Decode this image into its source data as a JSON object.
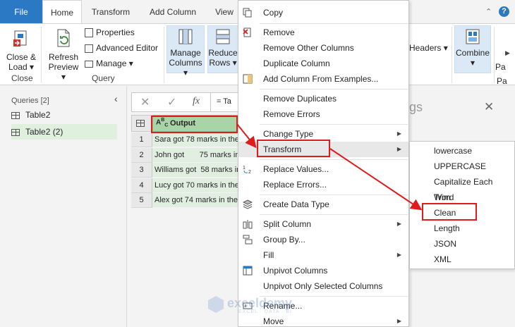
{
  "tabs": [
    {
      "label": "File"
    },
    {
      "label": "Home"
    },
    {
      "label": "Transform"
    },
    {
      "label": "Add Column"
    },
    {
      "label": "View"
    }
  ],
  "ribbon": {
    "close_load": "Close &\nLoad ▾",
    "close_load_1": "Close &",
    "close_load_2": "Load ▾",
    "close_group": "Close",
    "refresh_1": "Refresh",
    "refresh_2": "Preview ▾",
    "properties": "Properties",
    "advanced_editor": "Advanced Editor",
    "manage": "Manage ▾",
    "query_group": "Query",
    "manage_columns_1": "Manage",
    "manage_columns_2": "Columns ▾",
    "reduce_rows_1": "Reduce",
    "reduce_rows_2": "Rows ▾",
    "headers": "Headers ▾",
    "combine": "Combine",
    "combine_arrow": "▾",
    "cut_pa1": "Pa",
    "cut_pa2": "Pa",
    "help": "?"
  },
  "left_pane": {
    "header": "Queries [2]",
    "items": [
      "Table2",
      "Table2 (2)"
    ]
  },
  "formula_bar": {
    "fx": "fx",
    "eq_text": "= Ta"
  },
  "bg_title_fragment": "gs",
  "grid": {
    "column_header": "Output",
    "rows": [
      {
        "n": "1",
        "v": "Sara got 78 marks in the"
      },
      {
        "n": "2",
        "v": "John got       75 marks in"
      },
      {
        "n": "3",
        "v": "Williams got  58 marks in"
      },
      {
        "n": "4",
        "v": "Lucy got 70 marks in the"
      },
      {
        "n": "5",
        "v": "Alex got 74 marks in the"
      }
    ]
  },
  "context_menu": {
    "items": [
      "Copy",
      "Remove",
      "Remove Other Columns",
      "Duplicate Column",
      "Add Column From Examples...",
      "Remove Duplicates",
      "Remove Errors",
      "Change Type",
      "Transform",
      "Replace Values...",
      "Replace Errors...",
      "Create Data Type",
      "Split Column",
      "Group By...",
      "Fill",
      "Unpivot Columns",
      "Unpivot Only Selected Columns",
      "Rename...",
      "Move"
    ]
  },
  "transform_submenu": {
    "items": [
      "lowercase",
      "UPPERCASE",
      "Capitalize Each Word",
      "Trim",
      "Clean",
      "Length",
      "JSON",
      "XML"
    ]
  },
  "watermark": {
    "brand": "exceldemy",
    "tagline": "EXCEL · DATA · BI"
  },
  "colors": {
    "accent": "#2b78c5",
    "highlight_red": "#e11b1b",
    "selected_green": "#dff0df"
  }
}
